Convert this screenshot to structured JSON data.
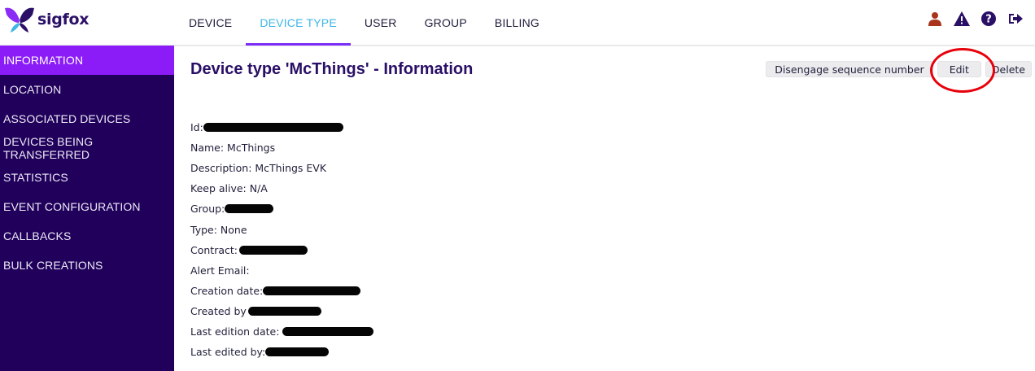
{
  "brand": {
    "name": "sigfox",
    "logo_color": "#2b1068",
    "accent": "#3fb6e8"
  },
  "nav": {
    "tabs": [
      {
        "label": "DEVICE",
        "active": false
      },
      {
        "label": "DEVICE TYPE",
        "active": true
      },
      {
        "label": "USER",
        "active": false
      },
      {
        "label": "GROUP",
        "active": false
      },
      {
        "label": "BILLING",
        "active": false
      }
    ],
    "active_color": "#3fb6e8",
    "underline_color": "#7b2cf5"
  },
  "top_icons": [
    "user-icon",
    "alert-icon",
    "help-icon",
    "logout-icon"
  ],
  "sidebar": {
    "background": "#21005c",
    "active_color": "#8b1cf7",
    "items": [
      {
        "label": "INFORMATION",
        "active": true
      },
      {
        "label": "LOCATION",
        "active": false
      },
      {
        "label": "ASSOCIATED DEVICES",
        "active": false
      },
      {
        "label": "DEVICES BEING TRANSFERRED",
        "active": false
      },
      {
        "label": "STATISTICS",
        "active": false
      },
      {
        "label": "EVENT CONFIGURATION",
        "active": false
      },
      {
        "label": "CALLBACKS",
        "active": false
      },
      {
        "label": "BULK CREATIONS",
        "active": false
      }
    ]
  },
  "main": {
    "title": "Device type 'McThings' - Information",
    "actions": {
      "disengage_label": "Disengage sequence number",
      "edit_label": "Edit",
      "delete_label": "Delete"
    },
    "annotation_color": "#e8000a",
    "fields": [
      {
        "label": "Id:",
        "value": "",
        "redacted": true
      },
      {
        "label": "Name: McThings",
        "value": "",
        "redacted": false
      },
      {
        "label": "Description: McThings EVK",
        "value": "",
        "redacted": false
      },
      {
        "label": "Keep alive: N/A",
        "value": "",
        "redacted": false
      },
      {
        "label": "Group:",
        "value": "",
        "redacted": true
      },
      {
        "label": "Type: None",
        "value": "",
        "redacted": false
      },
      {
        "label": "Contract:",
        "value": "",
        "redacted": true
      },
      {
        "label": "Alert Email:",
        "value": "",
        "redacted": false
      },
      {
        "label": "Creation date:",
        "value": "",
        "redacted": true
      },
      {
        "label": "Created by",
        "value": "",
        "redacted": true
      },
      {
        "label": "Last edition date:",
        "value": "",
        "redacted": true
      },
      {
        "label": "Last edited by:",
        "value": "",
        "redacted": true
      }
    ]
  }
}
